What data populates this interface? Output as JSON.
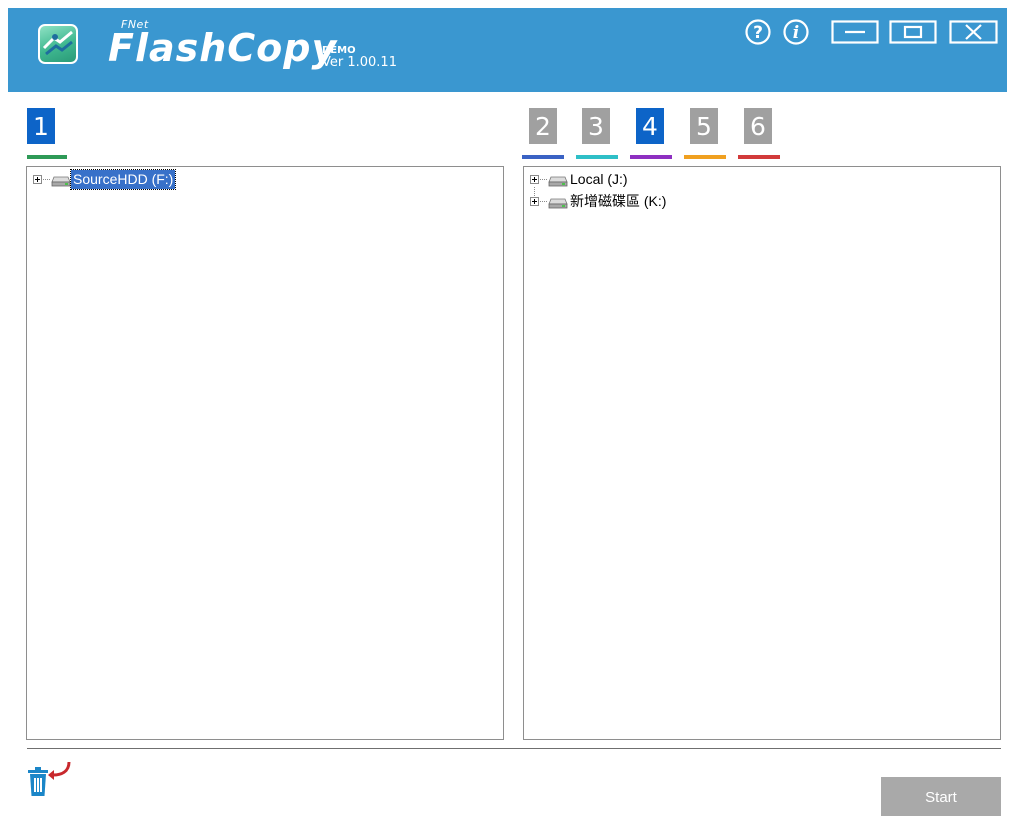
{
  "app": {
    "brand_small": "FNet",
    "brand_name": "FlashCopy",
    "edition": "DEMO",
    "version": "Ver 1.00.11"
  },
  "titlebar": {
    "buttons": [
      "help-icon",
      "info-icon",
      "minimize-icon",
      "maximize-icon",
      "close-icon"
    ]
  },
  "colors": {
    "titlebar": "#3a97d0",
    "tab_active": "#0d64c8",
    "tab_inactive": "#a0a0a0",
    "selection": "#3871c9",
    "start_button": "#a9a9a9"
  },
  "source": {
    "tab": {
      "label": "1",
      "underline_color": "#2e9a57"
    },
    "tree": [
      {
        "label": "SourceHDD (F:)",
        "selected": true
      }
    ]
  },
  "targets": {
    "tabs": [
      {
        "label": "2",
        "active": false,
        "underline_color": "#3a62c4"
      },
      {
        "label": "3",
        "active": false,
        "underline_color": "#2ebfc7"
      },
      {
        "label": "4",
        "active": true,
        "underline_color": "#8e2fc1"
      },
      {
        "label": "5",
        "active": false,
        "underline_color": "#f0a020"
      },
      {
        "label": "6",
        "active": false,
        "underline_color": "#d23a3a"
      }
    ],
    "tree": [
      {
        "label": "Local (J:)",
        "selected": false
      },
      {
        "label": "新增磁碟區 (K:)",
        "selected": false
      }
    ]
  },
  "footer": {
    "trash_icon": "trash-restore-icon",
    "start_label": "Start"
  }
}
